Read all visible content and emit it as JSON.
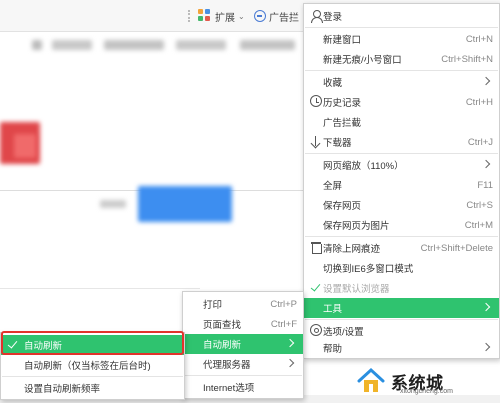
{
  "toolbar": {
    "extensions_label": "扩展",
    "adblock_label": "广告拦"
  },
  "main_menu": {
    "items": [
      {
        "label": "登录",
        "shortcut": "",
        "icon": "user-icon"
      },
      {
        "label": "新建窗口",
        "shortcut": "Ctrl+N"
      },
      {
        "label": "新建无痕/小号窗口",
        "shortcut": "Ctrl+Shift+N"
      },
      {
        "label": "收藏",
        "submenu": true
      },
      {
        "label": "历史记录",
        "shortcut": "Ctrl+H",
        "icon": "clock-icon"
      },
      {
        "label": "广告拦截"
      },
      {
        "label": "下载器",
        "shortcut": "Ctrl+J",
        "icon": "download-icon"
      },
      {
        "label": "网页缩放（110%）",
        "submenu": true
      },
      {
        "label": "全屏",
        "shortcut": "F11"
      },
      {
        "label": "保存网页",
        "shortcut": "Ctrl+S"
      },
      {
        "label": "保存网页为图片",
        "shortcut": "Ctrl+M"
      },
      {
        "label": "清除上网痕迹",
        "shortcut": "Ctrl+Shift+Delete",
        "icon": "trash-icon"
      },
      {
        "label": "切换到IE6多窗口模式"
      },
      {
        "label": "设置默认浏览器",
        "icon": "check-icon",
        "disabled": true
      },
      {
        "label": "工具",
        "submenu": true,
        "highlighted": true
      },
      {
        "label": "选项/设置",
        "icon": "gear-icon"
      },
      {
        "label": "帮助",
        "submenu": true
      }
    ]
  },
  "tools_menu": {
    "items": [
      {
        "label": "打印",
        "shortcut": "Ctrl+P"
      },
      {
        "label": "页面查找",
        "shortcut": "Ctrl+F"
      },
      {
        "label": "自动刷新",
        "submenu": true,
        "highlighted": true
      },
      {
        "label": "代理服务器",
        "submenu": true
      },
      {
        "label": "Internet选项"
      }
    ]
  },
  "refresh_menu": {
    "items": [
      {
        "label": "自动刷新",
        "checked": true,
        "highlighted": true
      },
      {
        "label": "自动刷新（仅当标签在后台时)"
      },
      {
        "label": "设置自动刷新频率"
      }
    ]
  },
  "watermark": {
    "title": "系统城",
    "domain": "xitongcheng.com"
  },
  "colors": {
    "highlight": "#2fc36f",
    "callout_border": "#e2332b"
  }
}
